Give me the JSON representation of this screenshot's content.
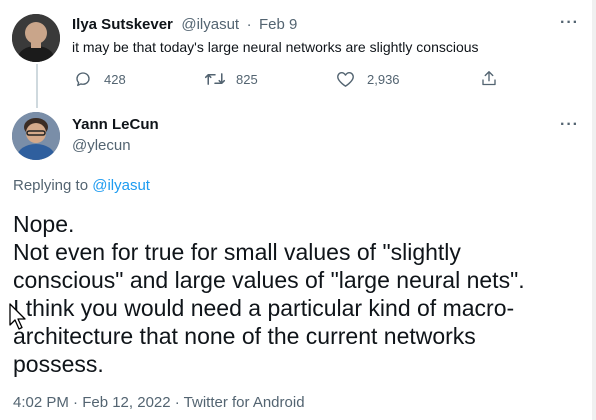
{
  "first_tweet": {
    "display_name": "Ilya Sutskever",
    "handle": "@ilyasut",
    "separator": "·",
    "date": "Feb 9",
    "text": "it may be that today's large neural networks are slightly conscious",
    "actions": {
      "replies": "428",
      "retweets": "825",
      "likes": "2,936"
    }
  },
  "main_tweet": {
    "display_name": "Yann LeCun",
    "handle": "@ylecun",
    "replying_prefix": "Replying to",
    "replying_to": "@ilyasut",
    "lines": [
      "Nope.",
      "Not even for true for small values of \"slightly",
      "conscious\" and large values of \"large neural nets\".",
      "I think you would need a particular kind of macro-",
      "architecture that none of the current networks",
      "possess."
    ],
    "footer": "4:02 PM · Feb 12, 2022 · Twitter for Android"
  },
  "icons": {
    "more": "more-icon",
    "reply": "reply-icon",
    "retweet": "retweet-icon",
    "like": "like-icon",
    "share": "share-icon"
  },
  "colors": {
    "accent": "#1d9bf0",
    "muted": "#536471",
    "text": "#0f1419"
  }
}
